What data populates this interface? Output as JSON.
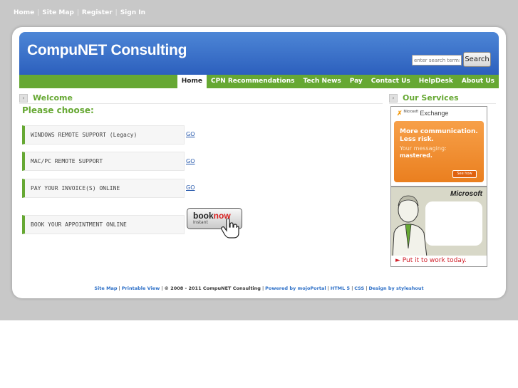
{
  "top_links": [
    "Home",
    "Site Map",
    "Register",
    "Sign In"
  ],
  "header": {
    "site_title": "CompuNET Consulting",
    "search_placeholder": "enter search terms",
    "search_button": "Search"
  },
  "nav": [
    "Home",
    "CPN Recommendations",
    "Tech News",
    "Pay",
    "Contact Us",
    "HelpDesk",
    "About Us"
  ],
  "main": {
    "section_title": "Welcome",
    "prompt": "Please choose:",
    "options": [
      {
        "label": "WINDOWS REMOTE SUPPORT (Legacy)",
        "link": "GO"
      },
      {
        "label": "MAC/PC REMOTE SUPPORT",
        "link": "GO"
      },
      {
        "label": "PAY YOUR INVOICE(S) ONLINE",
        "link": "GO"
      },
      {
        "label": "BOOK YOUR APPOINTMENT ONLINE"
      }
    ],
    "booknow": {
      "book": "book",
      "now": "now",
      "sub": "Instant"
    }
  },
  "sidebar": {
    "section_title": "Our Services",
    "ad1": {
      "logo_small": "Microsoft",
      "logo": "Exchange",
      "headline": "More communication. Less risk.",
      "sub1": "Your messaging:",
      "sub2": "mastered.",
      "button": "See how"
    },
    "ad2": {
      "logo": "Microsoft",
      "cta": "► Put it to work today."
    }
  },
  "footer": {
    "site_map": "Site Map",
    "printable": "Printable View",
    "copyright": "© 2008 - 2011 CompuNET Consulting",
    "powered": "Powered by mojoPortal",
    "html5": "HTML 5",
    "css": "CSS",
    "design": "Design by styleshout"
  }
}
